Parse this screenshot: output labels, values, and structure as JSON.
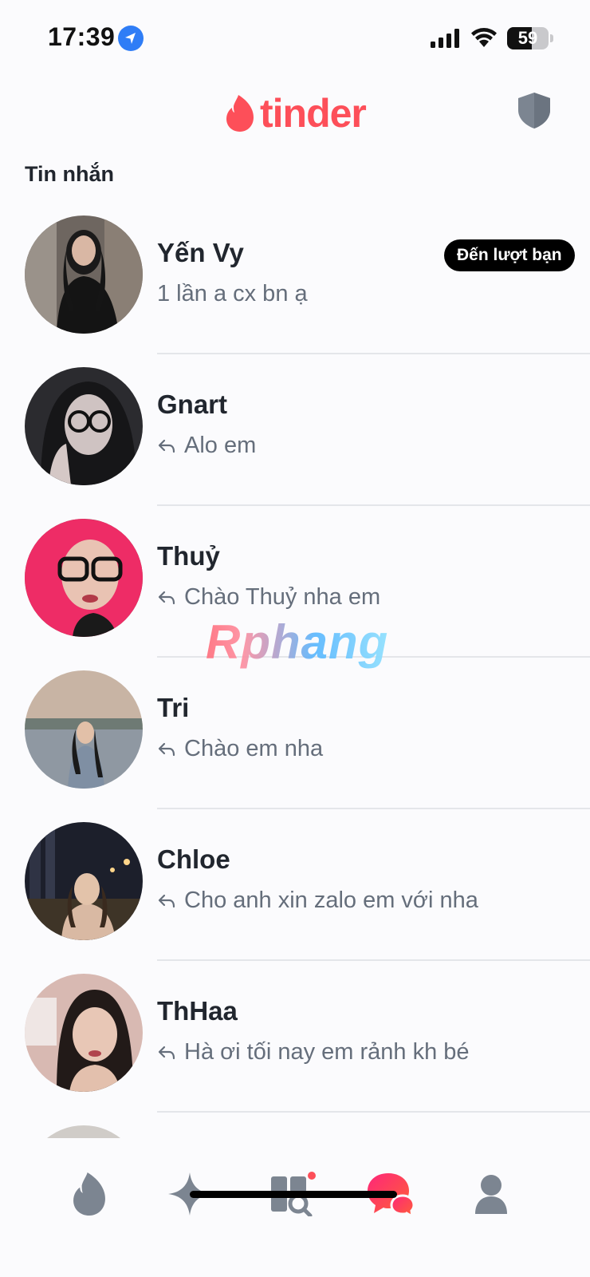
{
  "status_bar": {
    "time": "17:39",
    "battery_level": "59",
    "battery_percent": 59
  },
  "header": {
    "logo_text": "tinder",
    "brand_color": "#fd4f59"
  },
  "section": {
    "title": "Tin nhắn"
  },
  "messages": [
    {
      "name": "Yến Vy",
      "preview": "1 lần a cx bn ạ",
      "replied": false,
      "badge": "Đến lượt bạn"
    },
    {
      "name": "Gnart",
      "preview": "Alo em",
      "replied": true
    },
    {
      "name": "Thuỷ",
      "preview": "Chào Thuỷ nha em",
      "replied": true
    },
    {
      "name": "Tri",
      "preview": "Chào em nha",
      "replied": true
    },
    {
      "name": "Chloe",
      "preview": "Cho anh xin zalo em với nha",
      "replied": true
    },
    {
      "name": "ThHaa",
      "preview": "Hà ơi tối nay em rảnh kh bé",
      "replied": true
    }
  ],
  "watermark": {
    "text": "Rphang"
  },
  "nav": {
    "items": [
      "flame-icon",
      "sparkle-icon",
      "explore-icon",
      "chat-icon",
      "profile-icon"
    ],
    "active": "chat-icon"
  }
}
